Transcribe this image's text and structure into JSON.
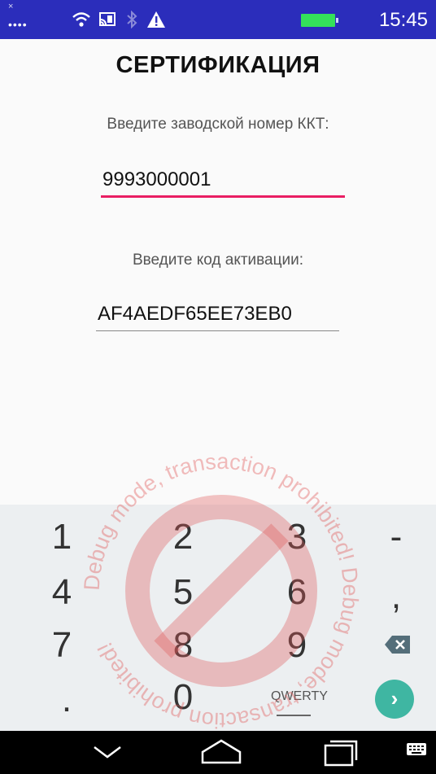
{
  "status_bar": {
    "close_glyph": "×",
    "signal_dots": "••••",
    "time": "15:45",
    "icons": [
      "signal-dots-icon",
      "wifi-icon",
      "cast-icon",
      "bluetooth-icon",
      "warning-icon",
      "battery-icon"
    ]
  },
  "screen": {
    "title": "СЕРТИФИКАЦИЯ",
    "serial": {
      "label": "Введите заводской номер ККТ:",
      "value": "9993000001"
    },
    "activation": {
      "label": "Введите код активации:",
      "value": "AF4AEDF65EE73EB0"
    }
  },
  "watermark": {
    "text": "Debug mode, transaction prohibited! Debug mode, transaction prohibited!"
  },
  "keyboard": {
    "rows": [
      [
        "1",
        "2",
        "3",
        "-"
      ],
      [
        "4",
        "5",
        "6",
        ","
      ],
      [
        "7",
        "8",
        "9"
      ],
      [
        ".",
        "0"
      ]
    ],
    "qwerty_label": "QWERTY",
    "go_glyph": "›",
    "icons": [
      "backspace-icon",
      "go-arrow-icon"
    ]
  },
  "nav_bar": {
    "icons": [
      "back-icon",
      "home-icon",
      "recents-icon",
      "keyboard-icon"
    ]
  },
  "colors": {
    "status_bar": "#2b2dbb",
    "active_underline": "#e91e63",
    "go_button": "#3fb6a2",
    "watermark": "#e05a5a"
  }
}
